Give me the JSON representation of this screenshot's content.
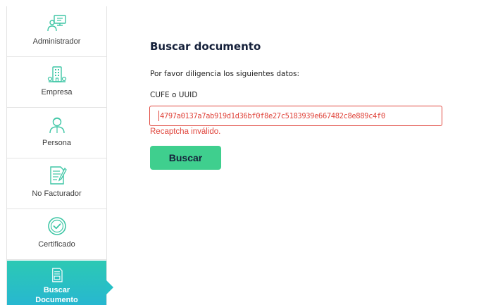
{
  "sidebar": {
    "items": [
      {
        "label": "Administrador",
        "icon": "admin-monitor-icon",
        "active": false
      },
      {
        "label": "Empresa",
        "icon": "building-icon",
        "active": false
      },
      {
        "label": "Persona",
        "icon": "person-icon",
        "active": false
      },
      {
        "label": "No Facturador",
        "icon": "document-pen-icon",
        "active": false
      },
      {
        "label": "Certificado",
        "icon": "certificate-check-icon",
        "active": false
      },
      {
        "label": "Buscar Documento",
        "icon": "search-document-icon",
        "active": true
      }
    ],
    "icon_color": "#3ec6a5",
    "active_color": "#2cc9b4"
  },
  "main": {
    "title": "Buscar documento",
    "instructions": "Por favor diligencia los siguientes datos:",
    "field_label": "CUFE o UUID",
    "cufe_value": "4797a0137a7ab919d1d36bf0f8e27c5183939e667482c8e889c4f0",
    "error_message": "Recaptcha inválido.",
    "search_button_label": "Buscar",
    "error_color": "#e0463d",
    "button_color": "#3fcf8e"
  }
}
